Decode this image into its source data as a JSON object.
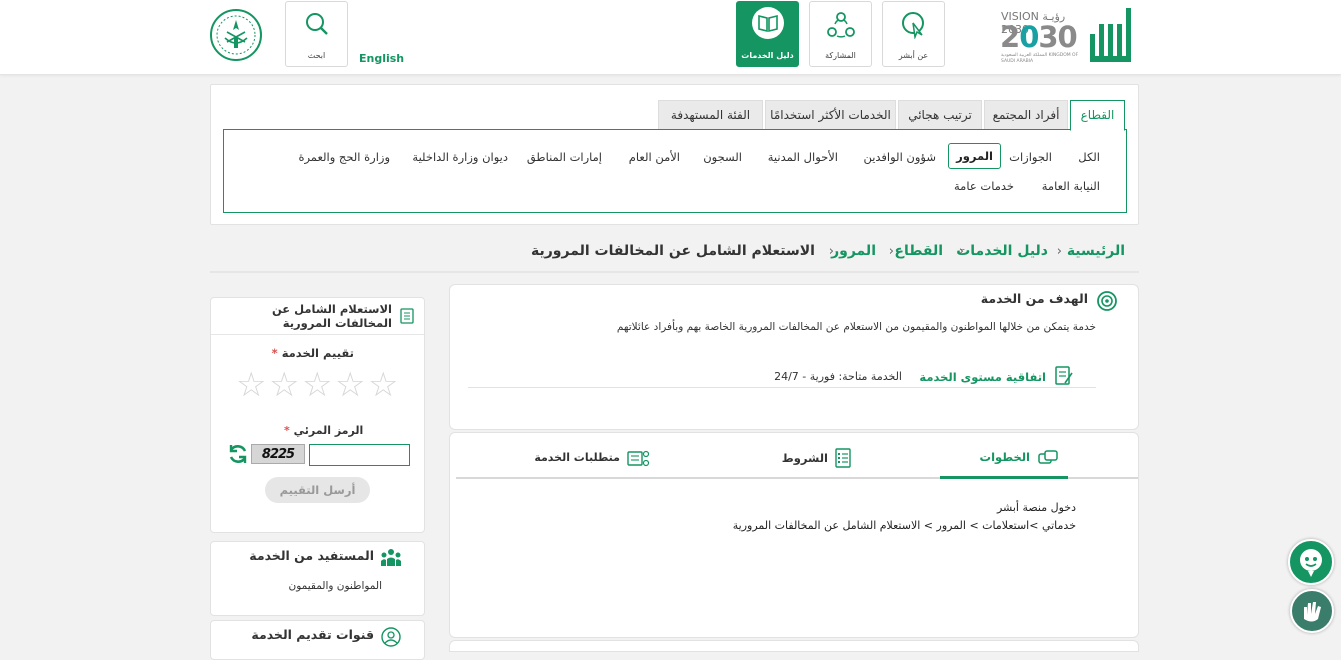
{
  "header": {
    "vision_logo_text": "VISION رؤيـة 2030",
    "vision_sub": "المملكة العربية السعودية KINGDOM OF SAUDI ARABIA",
    "nav": [
      {
        "label": "عن أبشر",
        "icon": "touch-icon"
      },
      {
        "label": "المشاركة",
        "icon": "participation-icon"
      },
      {
        "label": "دليل الخدمات",
        "icon": "book-icon"
      }
    ],
    "language": "English",
    "search_label": "ابحث"
  },
  "tabs": [
    "القطاع",
    "أفراد المجتمع",
    "ترتيب هجائي",
    "الخدمات الأكثر استخدامًا",
    "الفئة المستهدفة"
  ],
  "sectors": [
    "الكل",
    "الجوازات",
    "المرور",
    "شؤون الوافدين",
    "الأحوال المدنية",
    "السجون",
    "الأمن العام",
    "إمارات المناطق",
    "ديوان وزارة الداخلية",
    "وزارة الحج والعمرة",
    "النيابة العامة",
    "خدمات عامة"
  ],
  "breadcrumb": [
    "الرئيسية",
    "دليل الخدمات",
    "القطاع",
    "المرور",
    "الاستعلام الشامل عن المخالفات المرورية"
  ],
  "service": {
    "goal_title": "الهدف من الخدمة",
    "goal_text": "خدمة يتمكن من خلالها المواطنون والمقيمون من الاستعلام عن المخالفات المرورية الخاصة بهم وبأفراد عائلاتهم",
    "sla_label": "اتفاقية مستوى الخدمة",
    "availability": "الخدمة متاحة: فورية - 24/7"
  },
  "detail_tabs": [
    "الخطوات",
    "الشروط",
    "متطلبات الخدمة"
  ],
  "steps": [
    "دخول منصة أبشر",
    "خدماتي >استعلامات > المرور > الاستعلام الشامل عن المخالفات المرورية"
  ],
  "rating": {
    "title": "الاستعلام الشامل عن المخالفات المرورية",
    "rate_label": "تقييم الخدمة",
    "required": "*",
    "captcha_label": "الرمز المرئي",
    "captcha_value": "8225",
    "captcha_input": "",
    "submit": "أرسل التقييم",
    "stars": 5
  },
  "beneficiary": {
    "title": "المستفيد من الخدمة",
    "value": "المواطنون والمقيمون"
  },
  "channels": {
    "title": "قنوات تقديم الخدمة"
  },
  "colors": {
    "primary": "#149561",
    "bg": "#f2f2f2"
  }
}
